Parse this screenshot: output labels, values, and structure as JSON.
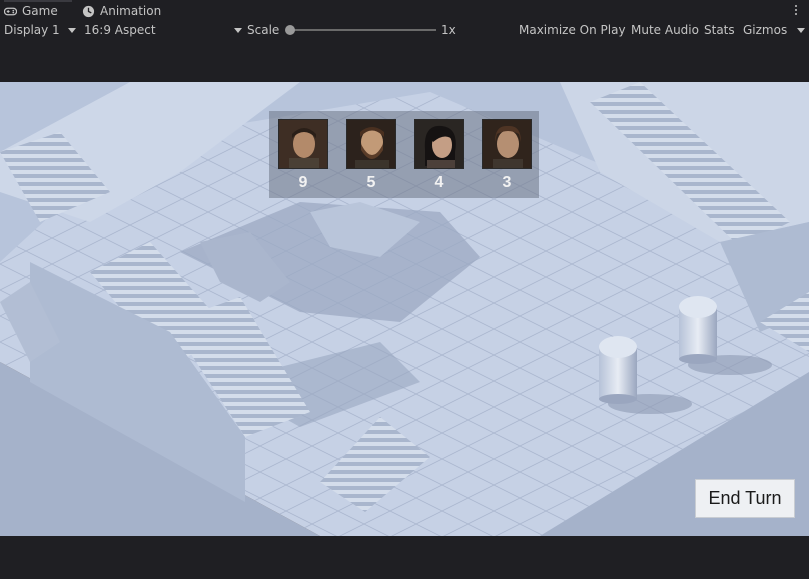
{
  "tabs": [
    {
      "label": "Game",
      "icon": "gamepad-icon"
    },
    {
      "label": "Animation",
      "icon": "clock-icon"
    }
  ],
  "toolbar": {
    "display": "Display 1",
    "aspect": "16:9 Aspect",
    "scale_label": "Scale",
    "scale_value": "1x",
    "maximize": "Maximize On Play",
    "mute": "Mute Audio",
    "stats": "Stats",
    "gizmos": "Gizmos"
  },
  "game": {
    "turn_order": [
      {
        "portrait": "man-short-hair-portrait",
        "initiative": "9"
      },
      {
        "portrait": "bearded-man-portrait",
        "initiative": "5"
      },
      {
        "portrait": "dark-haired-woman-portrait",
        "initiative": "4"
      },
      {
        "portrait": "young-man-portrait",
        "initiative": "3"
      }
    ],
    "end_turn_label": "End Turn"
  },
  "colors": {
    "editor_bg": "#1f1f23",
    "editor_text": "#c4c4c4",
    "tile": "#c3cfe3",
    "shadow": "#8e99b3",
    "ground": "#6e5b4c",
    "panel": "#6e7687"
  }
}
